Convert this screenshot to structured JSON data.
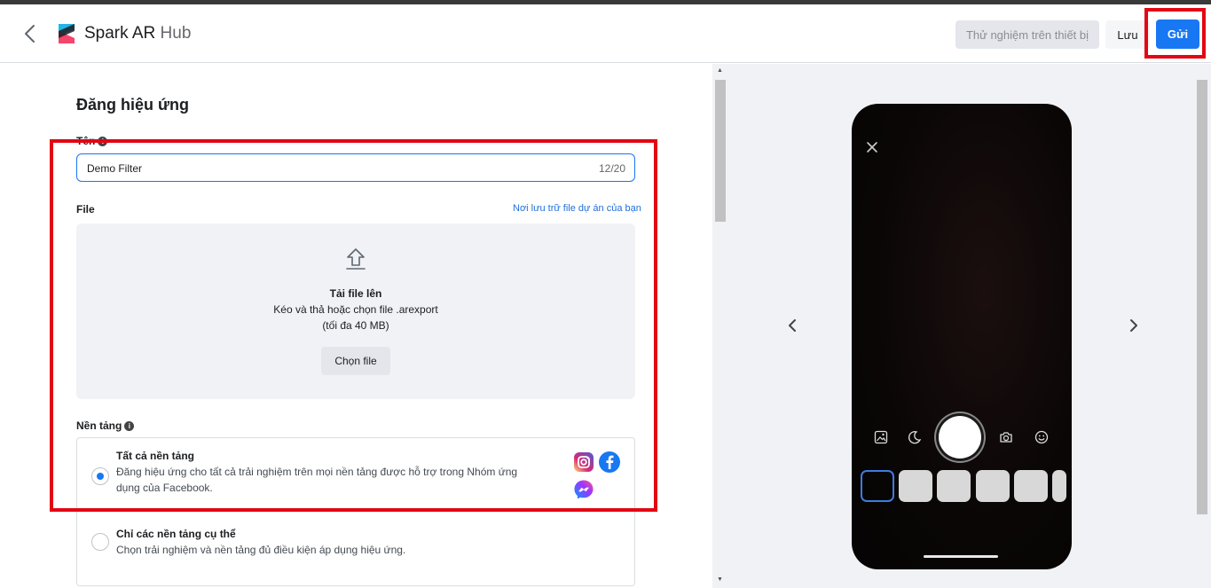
{
  "header": {
    "brand_name": "Spark AR",
    "brand_suffix": "Hub",
    "test_button": "Thử nghiệm trên thiết bị",
    "save_button": "Lưu",
    "send_button": "Gửi"
  },
  "form": {
    "title": "Đăng hiệu ứng",
    "name_label": "Tên",
    "name_value": "Demo Filter",
    "name_counter": "12/20",
    "file_label": "File",
    "storage_link": "Nơi lưu trữ file dự án của bạn",
    "upload_title": "Tải file lên",
    "upload_desc": "Kéo và thả hoặc chọn file .arexport",
    "upload_limit": "(tối đa 40 MB)",
    "choose_button": "Chọn file",
    "platform_label": "Nền tảng",
    "options": [
      {
        "title": "Tất cả nền tảng",
        "desc_line1": "Đăng hiệu ứng cho tất cả trải nghiệm trên mọi nền tảng được hỗ trợ trong Nhóm ứng",
        "desc_line2": "dụng của Facebook.",
        "selected": true
      },
      {
        "title": "Chỉ các nền tảng cụ thể",
        "desc_line1": "Chọn trải nghiệm và nền tảng đủ điều kiện áp dụng hiệu ứng.",
        "selected": false
      }
    ]
  },
  "colors": {
    "accent": "#1877f2",
    "highlight": "#e30613",
    "instagram": "#d62976",
    "facebook": "#1877f2",
    "messenger": "#8a4dff"
  },
  "icons": [
    "back-icon",
    "spark-ar-logo",
    "info-icon",
    "upload-icon",
    "instagram-icon",
    "facebook-icon",
    "messenger-icon",
    "close-icon",
    "gallery-icon",
    "night-mode-icon",
    "flip-camera-icon",
    "face-icon",
    "chevron-left-icon",
    "chevron-right-icon"
  ]
}
